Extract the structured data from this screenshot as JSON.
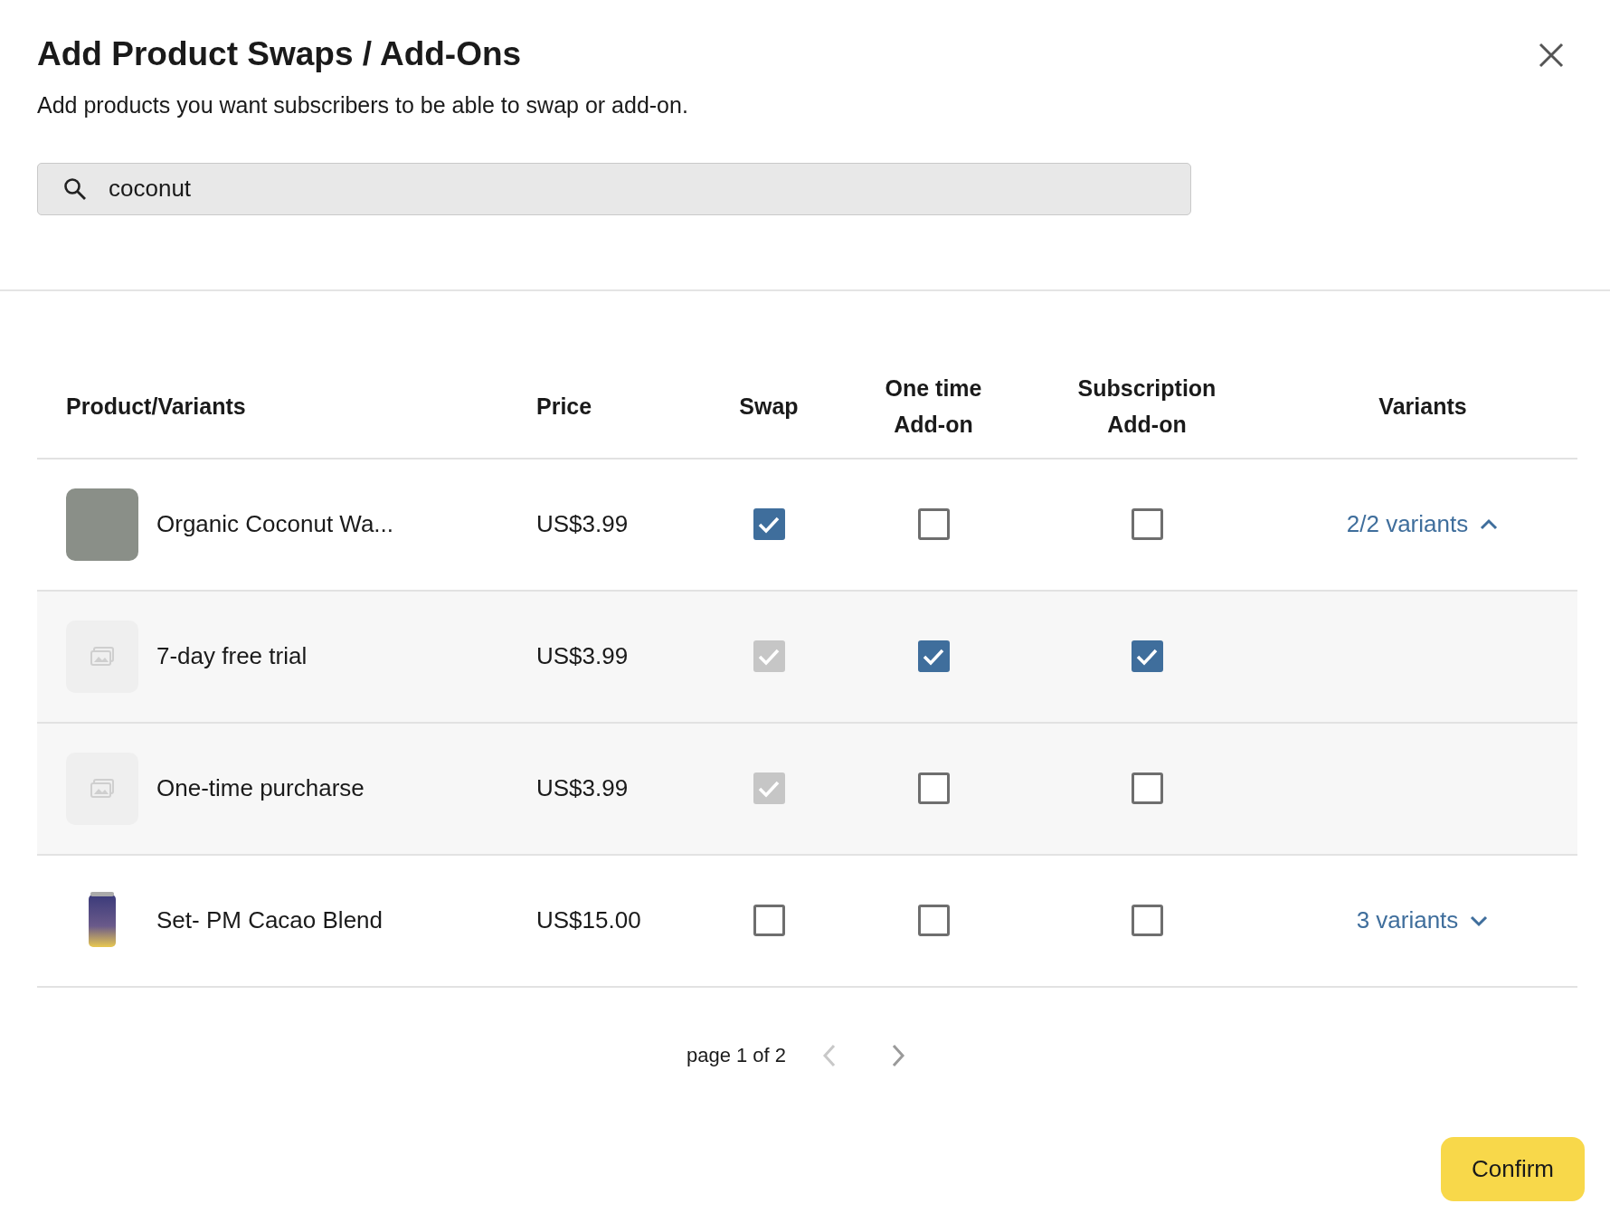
{
  "dialog": {
    "title": "Add Product Swaps / Add-Ons",
    "subtitle": "Add products you want subscribers to be able to swap or add-on."
  },
  "search": {
    "value": "coconut"
  },
  "table": {
    "columns": [
      "Product/Variants",
      "Price",
      "Swap",
      "One time Add-on",
      "Subscription Add-on",
      "Variants"
    ],
    "rows": [
      {
        "kind": "product",
        "name": "Organic Coconut Wa...",
        "price": "US$3.99",
        "swap": {
          "checked": true,
          "disabled": false
        },
        "one_time": {
          "checked": false,
          "disabled": false
        },
        "subscription": {
          "checked": false,
          "disabled": false
        },
        "variants": {
          "label": "2/2 variants",
          "expanded": true
        },
        "children": [
          {
            "kind": "variant",
            "name": "7-day free trial",
            "price": "US$3.99",
            "swap": {
              "checked": true,
              "disabled": true
            },
            "one_time": {
              "checked": true,
              "disabled": false
            },
            "subscription": {
              "checked": true,
              "disabled": false
            }
          },
          {
            "kind": "variant",
            "name": "One-time purcharse",
            "price": "US$3.99",
            "swap": {
              "checked": true,
              "disabled": true
            },
            "one_time": {
              "checked": false,
              "disabled": false
            },
            "subscription": {
              "checked": false,
              "disabled": false
            }
          }
        ]
      },
      {
        "kind": "product",
        "name": "Set- PM Cacao Blend",
        "price": "US$15.00",
        "swap": {
          "checked": false,
          "disabled": false
        },
        "one_time": {
          "checked": false,
          "disabled": false
        },
        "subscription": {
          "checked": false,
          "disabled": false
        },
        "variants": {
          "label": "3 variants",
          "expanded": false
        }
      }
    ]
  },
  "pagination": {
    "label": "page 1 of 2",
    "prev_disabled": true,
    "next_disabled": false
  },
  "buttons": [
    {
      "label": "Confirm"
    }
  ]
}
